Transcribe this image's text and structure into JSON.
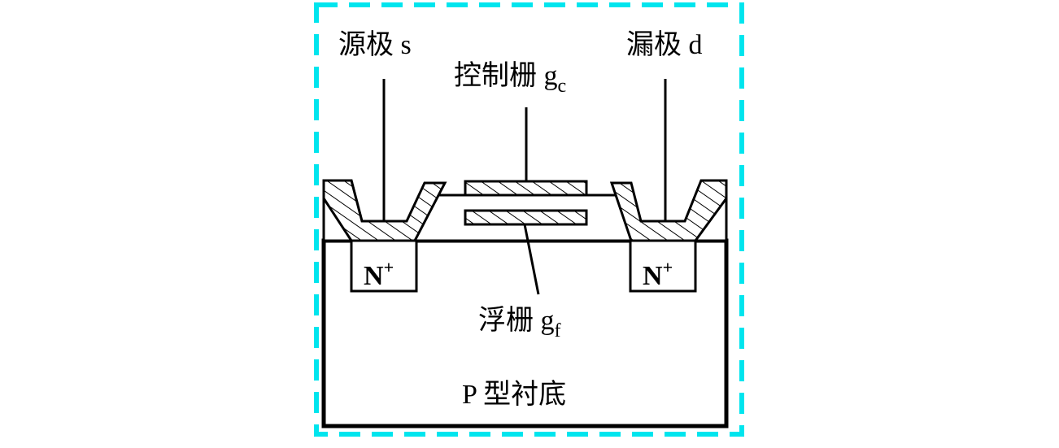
{
  "labels": {
    "source": "源极 s",
    "drain": "漏极 d",
    "control_gate": "控制栅 g",
    "control_gate_sub": "c",
    "floating_gate": "浮栅 g",
    "floating_gate_sub": "f",
    "substrate": "P 型衬底",
    "n_plus": "N",
    "n_plus_sup": "+"
  },
  "colors": {
    "frame": "#00e5ee",
    "line": "#000000"
  }
}
